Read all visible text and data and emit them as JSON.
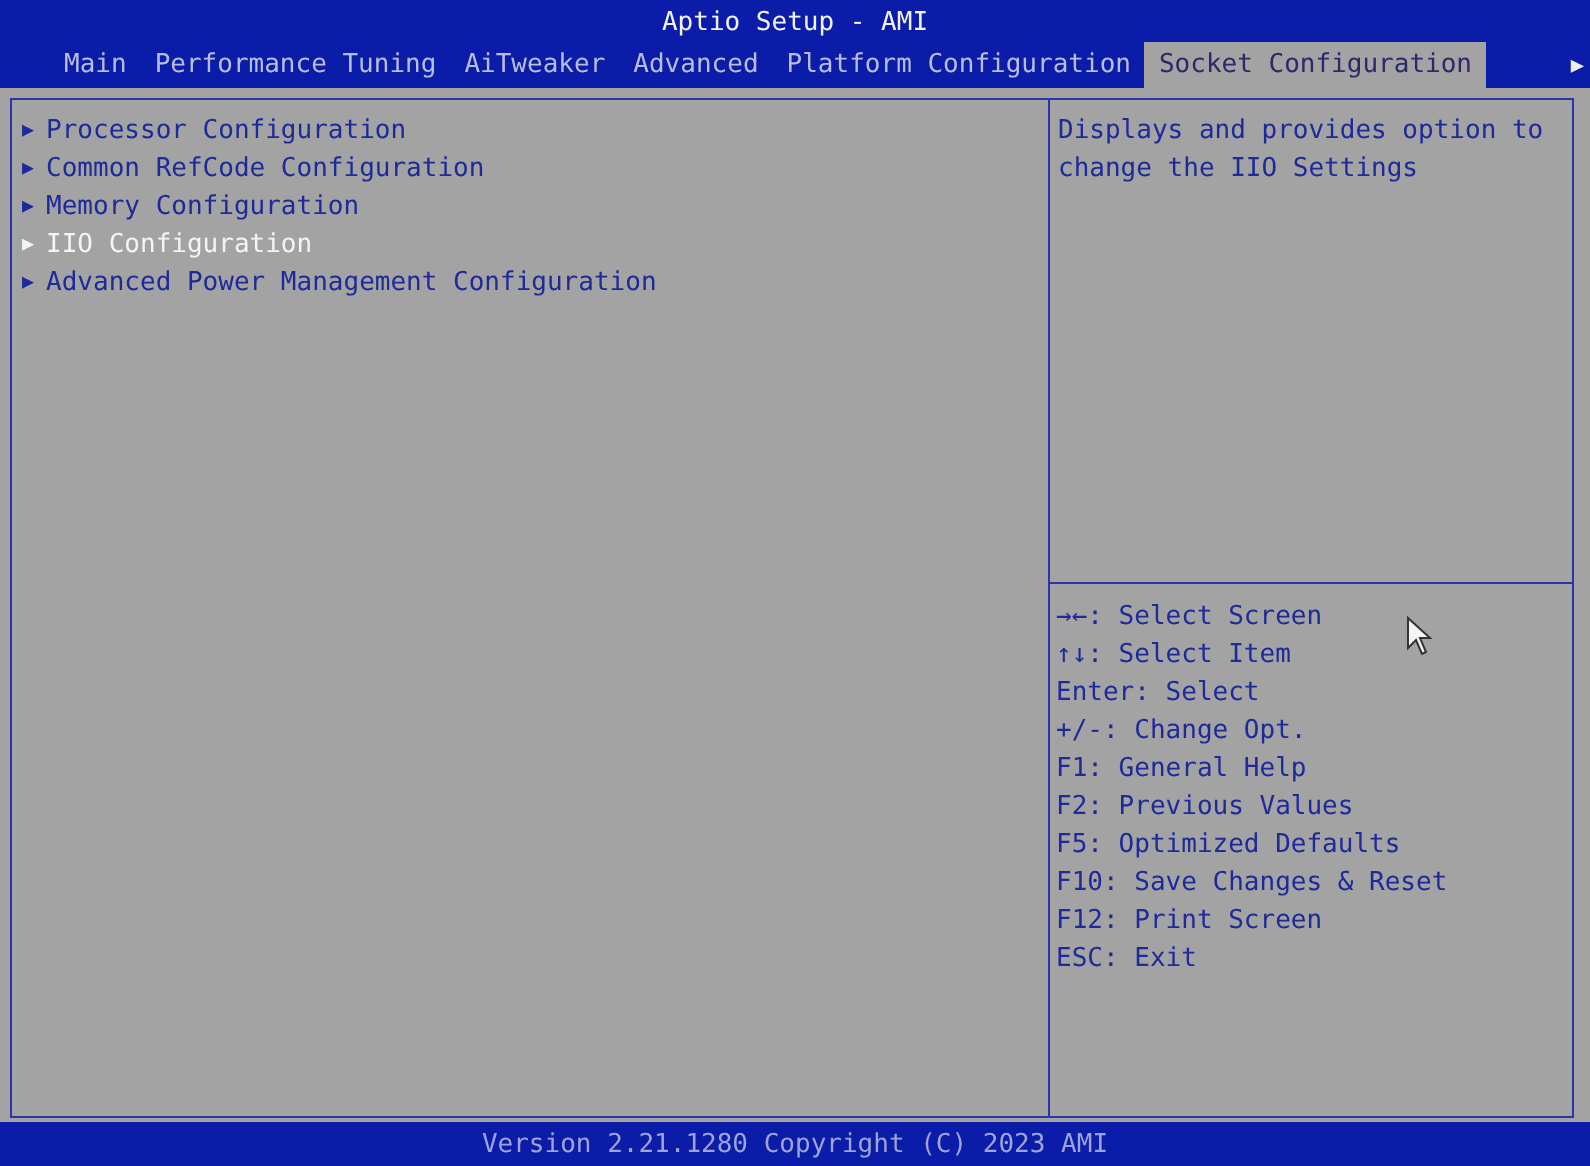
{
  "window": {
    "title": "Aptio Setup - AMI"
  },
  "tabs": [
    {
      "label": "Main",
      "selected": false
    },
    {
      "label": "Performance Tuning",
      "selected": false
    },
    {
      "label": "AiTweaker",
      "selected": false
    },
    {
      "label": "Advanced",
      "selected": false
    },
    {
      "label": "Platform Configuration",
      "selected": false
    },
    {
      "label": "Socket Configuration",
      "selected": true
    }
  ],
  "tab_scroll": "▶",
  "menu": [
    {
      "arrow": "▶",
      "label": "Processor Configuration",
      "selected": false
    },
    {
      "arrow": "▶",
      "label": "Common RefCode Configuration",
      "selected": false
    },
    {
      "arrow": "▶",
      "label": "Memory Configuration",
      "selected": false
    },
    {
      "arrow": "▶",
      "label": "IIO Configuration",
      "selected": true
    },
    {
      "arrow": "▶",
      "label": "Advanced Power Management Configuration",
      "selected": false
    }
  ],
  "help_text": "Displays and provides option to change the IIO Settings",
  "key_help": [
    "→←: Select Screen",
    "↑↓: Select Item",
    "Enter: Select",
    "+/-: Change Opt.",
    "F1: General Help",
    "F2: Previous Values",
    "F5: Optimized Defaults",
    "F10: Save Changes & Reset",
    "F12: Print Screen",
    "ESC: Exit"
  ],
  "status_bar": "Version 2.21.1280 Copyright (C) 2023 AMI"
}
